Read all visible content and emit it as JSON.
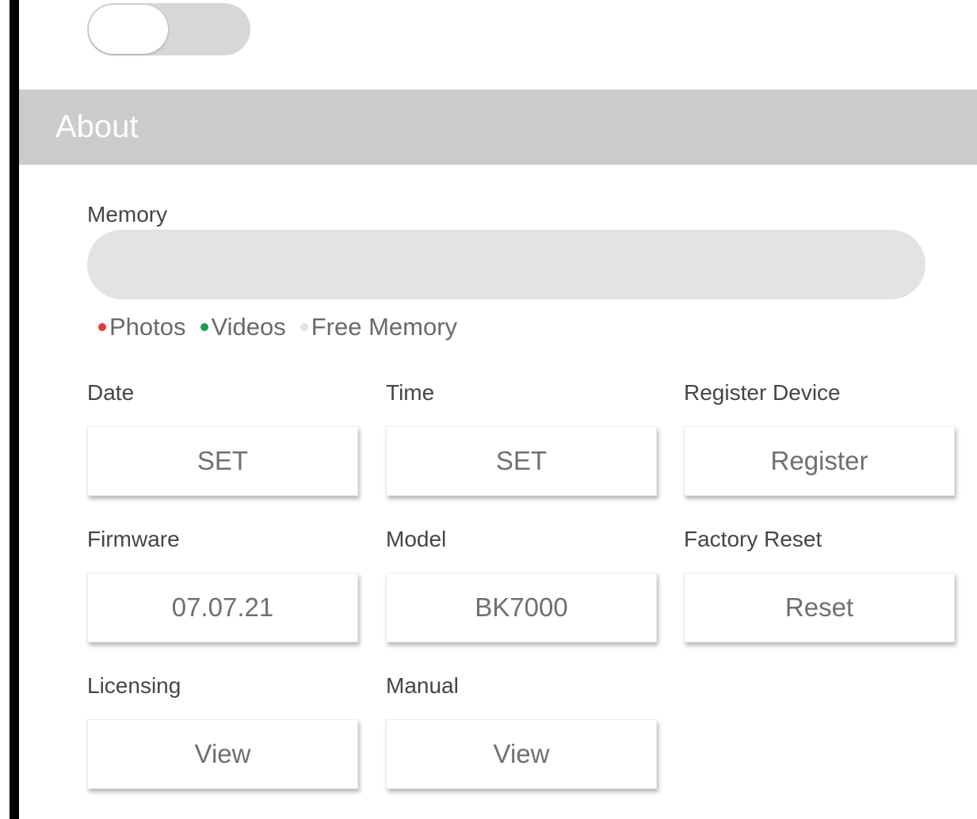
{
  "colors": {
    "header_bg": "#cbcbcb",
    "photos": "#e53935",
    "videos": "#1a9e4a",
    "free_memory": "#e3e3e3"
  },
  "section": {
    "title": "About"
  },
  "memory": {
    "label": "Memory",
    "legend": [
      {
        "label": "Photos",
        "color": "#e53935"
      },
      {
        "label": "Videos",
        "color": "#1a9e4a"
      },
      {
        "label": "Free Memory",
        "color": "#e3e3e3"
      }
    ]
  },
  "settings": {
    "date": {
      "label": "Date",
      "button": "SET"
    },
    "time": {
      "label": "Time",
      "button": "SET"
    },
    "register": {
      "label": "Register Device",
      "button": "Register"
    },
    "firmware": {
      "label": "Firmware",
      "value": "07.07.21"
    },
    "model": {
      "label": "Model",
      "value": "BK7000"
    },
    "factory_reset": {
      "label": "Factory Reset",
      "button": "Reset"
    },
    "licensing": {
      "label": "Licensing",
      "button": "View"
    },
    "manual": {
      "label": "Manual",
      "button": "View"
    }
  }
}
